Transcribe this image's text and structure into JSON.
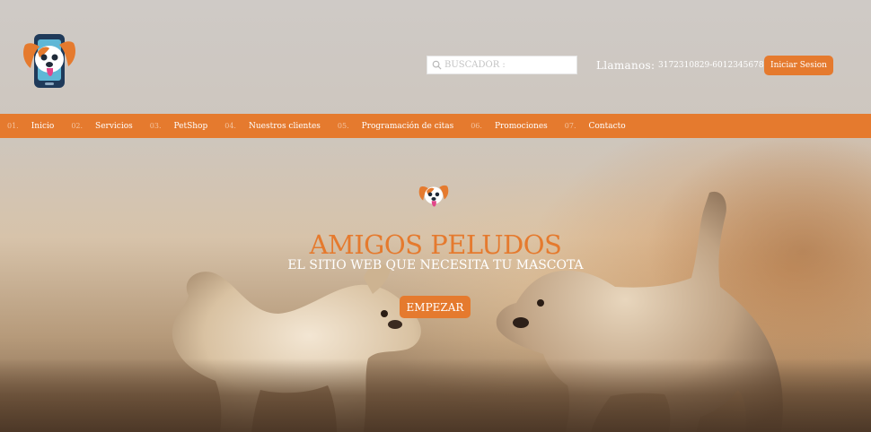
{
  "header": {
    "search": {
      "placeholder": "BUSCADOR :"
    },
    "call_label": "Llamanos:",
    "phones": "3172310829-6012345678",
    "login_label": "Iniciar Sesion"
  },
  "nav": {
    "items": [
      {
        "num": "01.",
        "label": "Inicio"
      },
      {
        "num": "02.",
        "label": "Servicios"
      },
      {
        "num": "03.",
        "label": "PetShop"
      },
      {
        "num": "04.",
        "label": "Nuestros clientes"
      },
      {
        "num": "05.",
        "label": "Programación de citas"
      },
      {
        "num": "06.",
        "label": "Promociones"
      },
      {
        "num": "07.",
        "label": "Contacto"
      }
    ]
  },
  "hero": {
    "title": "AMIGOS PELUDOS",
    "subtitle": "EL SITIO WEB QUE NECESITA TU MASCOTA",
    "cta_label": "EMPEZAR"
  },
  "colors": {
    "accent": "#e57a2e",
    "text_light": "#ffffff"
  },
  "icons": [
    "dog-phone-logo-icon",
    "search-icon"
  ]
}
